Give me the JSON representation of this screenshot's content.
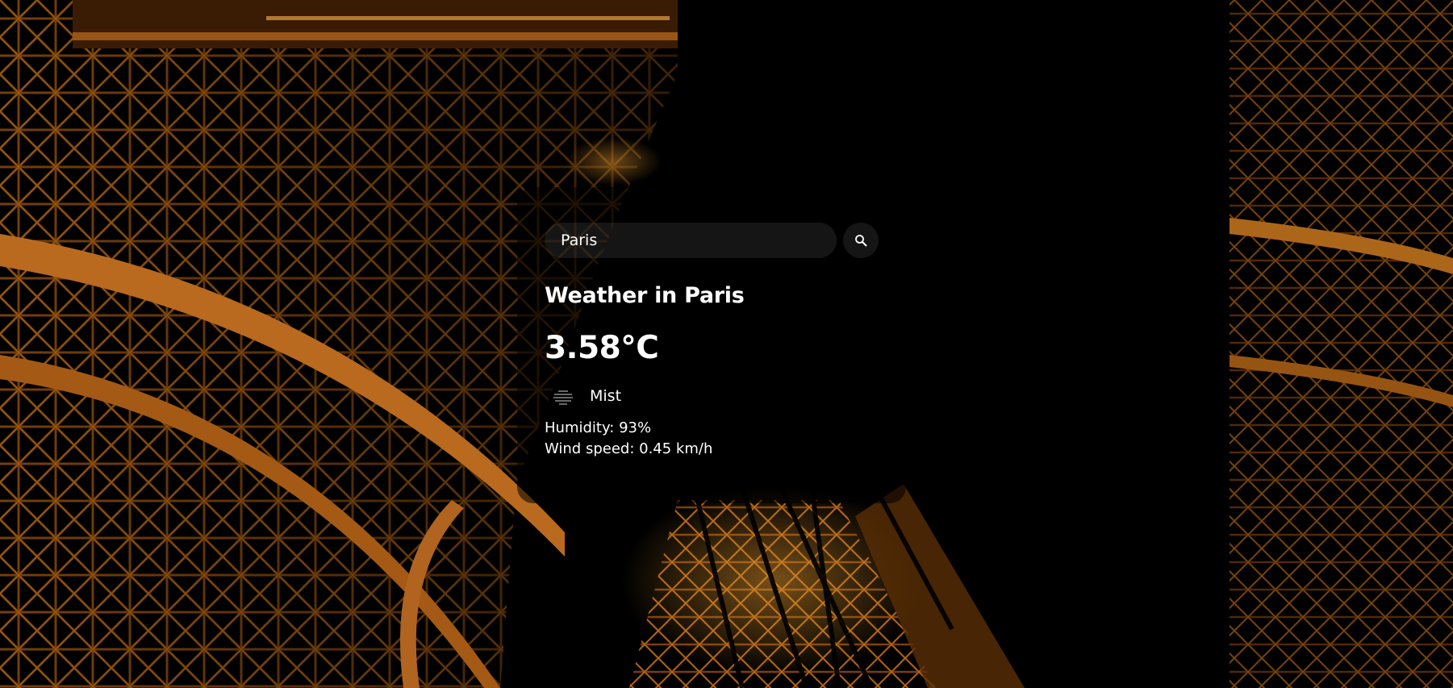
{
  "search": {
    "value": "Paris",
    "placeholder": "Search"
  },
  "weather": {
    "title": "Weather in Paris",
    "temperature": "3.58°C",
    "description": "Mist",
    "humidity": "Humidity: 93%",
    "wind": "Wind speed: 0.45 km/h",
    "icon": "mist-icon"
  },
  "background": {
    "subject": "eiffel-tower-night-photo",
    "colors": {
      "glow": "#e08a1c",
      "deep": "#5a2e05",
      "dark": "#000000"
    }
  },
  "icons": {
    "search": "search-icon"
  }
}
